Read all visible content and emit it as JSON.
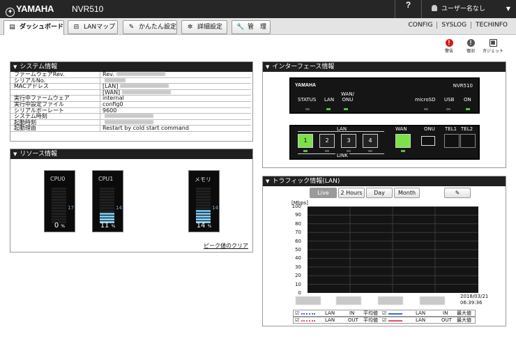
{
  "header": {
    "logo": "YAMAHA",
    "model": "NVR510",
    "help": "?",
    "user": "ユーザー名なし"
  },
  "tabs": [
    {
      "label": "ダッシュボード",
      "icon": "dashboard-icon"
    },
    {
      "label": "LANマップ",
      "icon": "lan-map-icon"
    },
    {
      "label": "かんたん設定",
      "icon": "wizard-icon"
    },
    {
      "label": "詳細設定",
      "icon": "gear-icon"
    },
    {
      "label": "管　理",
      "icon": "wrench-icon"
    }
  ],
  "toplinks": [
    "CONFIG",
    "SYSLOG",
    "TECHINFO"
  ],
  "quick": [
    {
      "label": "警告",
      "color": "#d11a1a"
    },
    {
      "label": "復旧",
      "color": "#555555"
    },
    {
      "label": "ガジェット",
      "color": "#555555"
    }
  ],
  "system": {
    "title": "システム情報",
    "rows": [
      {
        "key": "ファームウェアRev.",
        "value": "Rev."
      },
      {
        "key": "シリアルNo.",
        "value": ""
      },
      {
        "key": "MACアドレス",
        "value": "[LAN]"
      },
      {
        "key": "",
        "value": "[WAN]"
      },
      {
        "key": "実行中ファームウェア",
        "value": "internal"
      },
      {
        "key": "実行中設定ファイル",
        "value": "config0"
      },
      {
        "key": "シリアルボーレート",
        "value": "9600"
      },
      {
        "key": "システム時刻",
        "value": ""
      },
      {
        "key": "起動時刻",
        "value": ""
      },
      {
        "key": "起動理由",
        "value": "Restart by cold start command"
      }
    ]
  },
  "resource": {
    "title": "リソース情報",
    "clear": "ピーク値のクリア",
    "meters": [
      {
        "name": "CPU0",
        "value": 0,
        "peak": "17",
        "unit": "%"
      },
      {
        "name": "CPU1",
        "value": 11,
        "peak": "14",
        "unit": "%"
      },
      {
        "name": "メモリ",
        "value": 14,
        "peak": "14",
        "unit": "%"
      }
    ]
  },
  "iface": {
    "title": "インターフェース情報",
    "brand": "YAMAHA",
    "model": "NVR510",
    "leds": [
      {
        "label": "STATUS",
        "on": false
      },
      {
        "label": "LAN",
        "on": true
      },
      {
        "label": "WAN/\nONU",
        "on": true
      },
      {
        "label": "microSD",
        "on": false
      },
      {
        "label": "USB",
        "on": false
      },
      {
        "label": "ON",
        "on": true
      }
    ],
    "lan_label": "LAN",
    "link_label": "LINK",
    "wan_label": "WAN",
    "onu_label": "ONU",
    "tel1": "TEL1",
    "tel2": "TEL2",
    "lan_ports": [
      {
        "n": "1",
        "active": true
      },
      {
        "n": "2",
        "active": false
      },
      {
        "n": "3",
        "active": false
      },
      {
        "n": "4",
        "active": false
      }
    ],
    "wan_active": true
  },
  "traffic": {
    "title": "トラフィック情報(LAN)",
    "ranges": [
      "Live",
      "2 Hours",
      "Day",
      "Month"
    ],
    "active": "Live",
    "unit": "[Mbps]",
    "timestamp_date": "2018/03/21",
    "timestamp_time": "06:39:36",
    "legend": [
      [
        "LAN",
        "IN",
        "平均値",
        "LAN",
        "IN",
        "最大値"
      ],
      [
        "LAN",
        "OUT",
        "平均値",
        "LAN",
        "OUT",
        "最大値"
      ]
    ]
  },
  "chart_data": {
    "type": "line",
    "ylabel": "[Mbps]",
    "ylim": [
      0,
      100
    ],
    "yticks": [
      0,
      10,
      20,
      30,
      40,
      50,
      60,
      70,
      80,
      90,
      100
    ],
    "grid": true,
    "series": [
      {
        "values": []
      },
      {
        "values": []
      },
      {
        "values": []
      },
      {
        "values": []
      }
    ]
  }
}
